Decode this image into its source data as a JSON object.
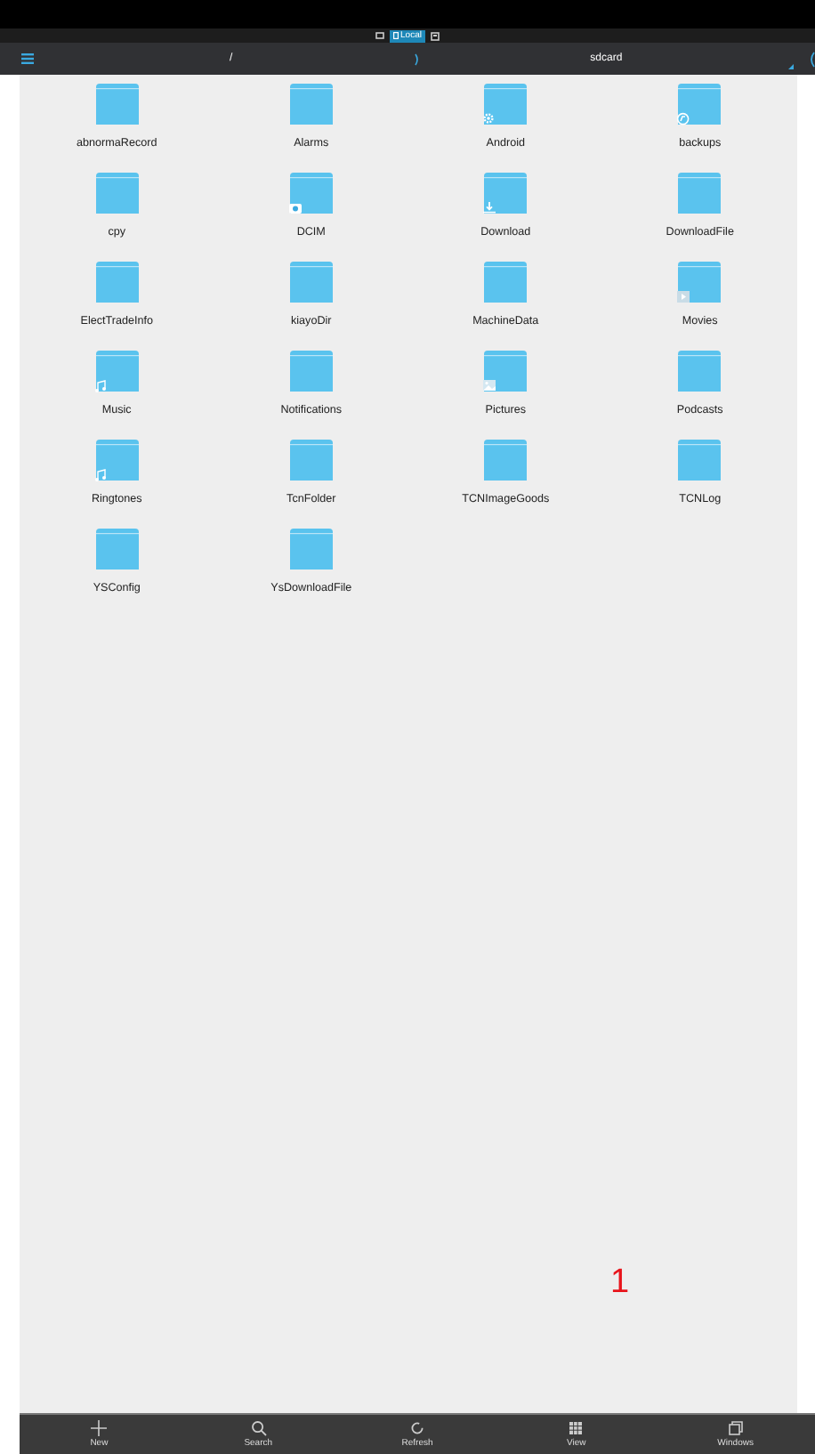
{
  "window_bar": {
    "tabs": [
      {
        "label": "Local",
        "selected": true
      }
    ]
  },
  "toolbar": {
    "path": [
      {
        "label": "/"
      },
      {
        "label": "sdcard"
      }
    ]
  },
  "folders": [
    {
      "name": "abnormaRecord",
      "kind": "plain"
    },
    {
      "name": "Alarms",
      "kind": "plain"
    },
    {
      "name": "Android",
      "kind": "gear"
    },
    {
      "name": "backups",
      "kind": "backup"
    },
    {
      "name": "cpy",
      "kind": "plain"
    },
    {
      "name": "DCIM",
      "kind": "camera"
    },
    {
      "name": "Download",
      "kind": "download"
    },
    {
      "name": "DownloadFile",
      "kind": "plain"
    },
    {
      "name": "ElectTradeInfo",
      "kind": "plain"
    },
    {
      "name": "kiayoDir",
      "kind": "plain"
    },
    {
      "name": "MachineData",
      "kind": "plain"
    },
    {
      "name": "Movies",
      "kind": "video"
    },
    {
      "name": "Music",
      "kind": "music"
    },
    {
      "name": "Notifications",
      "kind": "plain"
    },
    {
      "name": "Pictures",
      "kind": "image"
    },
    {
      "name": "Podcasts",
      "kind": "plain"
    },
    {
      "name": "Ringtones",
      "kind": "music"
    },
    {
      "name": "TcnFolder",
      "kind": "plain"
    },
    {
      "name": "TCNImageGoods",
      "kind": "plain"
    },
    {
      "name": "TCNLog",
      "kind": "plain"
    },
    {
      "name": "YSConfig",
      "kind": "plain"
    },
    {
      "name": "YsDownloadFile",
      "kind": "plain"
    }
  ],
  "annotation": "1",
  "bottom_bar": [
    {
      "label": "New",
      "kind": "new"
    },
    {
      "label": "Search",
      "kind": "search"
    },
    {
      "label": "Refresh",
      "kind": "refresh"
    },
    {
      "label": "View",
      "kind": "view"
    },
    {
      "label": "Windows",
      "kind": "windows"
    }
  ]
}
